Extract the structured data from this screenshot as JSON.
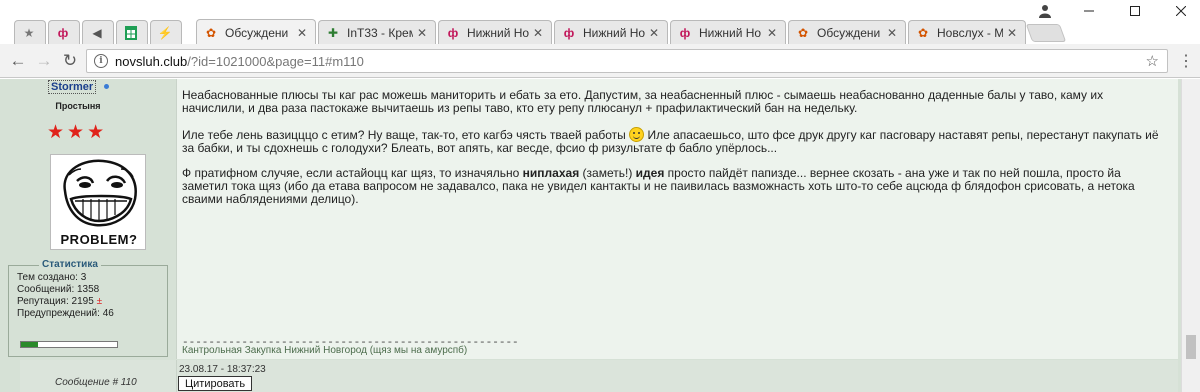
{
  "tabs": [
    {
      "label": "",
      "icon": "star-icon"
    },
    {
      "label": "",
      "icon": "novsluh-favicon"
    },
    {
      "label": "",
      "icon": "speaker-icon"
    },
    {
      "label": "",
      "icon": "sheets-icon"
    },
    {
      "label": "",
      "icon": "bolt-icon"
    },
    {
      "label": "Обсуждени",
      "icon": "forum-favicon",
      "active": true
    },
    {
      "label": "InT33 - Крем",
      "icon": "int33-favicon"
    },
    {
      "label": "Нижний Но",
      "icon": "novsluh-favicon"
    },
    {
      "label": "Нижний Но",
      "icon": "novsluh-favicon"
    },
    {
      "label": "Нижний Но",
      "icon": "novsluh-favicon"
    },
    {
      "label": "Обсуждени",
      "icon": "forum-favicon"
    },
    {
      "label": "Новслух - М",
      "icon": "forum-favicon"
    }
  ],
  "omnibox": {
    "host": "novsluh.club",
    "path": "/?id=1021000&page=11#m110"
  },
  "profile": {
    "username": "Stormer",
    "rank": "Простыня",
    "avatar_caption": "PROBLEM?",
    "stats_title": "Статистика",
    "stats": [
      "Тем создано: 3",
      "Сообщений: 1358",
      "Репутация: 2195",
      "Предупреждений: 46"
    ],
    "rep_sign": "±",
    "rep_fraction": 0.18
  },
  "post": {
    "p1": "Неабаснованные плюсы ты каг рас можешь маниторить и ебать за ето. Дапустим, за неабасненный плюс - сымаешь неабаснованно даденные балы у таво, каму их начислили, и два раза пастокаже вычитаешь из репы таво, кто ету репу плюсанул + прафилактический бан на недельку.",
    "p2a": "Иле тебе лень вазицццо с етим? Ну ваще, так-то, ето кагбэ чясть тваей работы ",
    "p2b": " Иле апасаешьсо, што фсе друк другу каг пасговару наставят репы, перестанут пакупать иё за бабки, и ты сдохнешь с голодухи? Блеать, вот апять, каг весде, фсио ф ризультате ф бабло упёрлось...",
    "p3a": "Ф пратифном случяе, если астайоцц каг щяз, то изначяльно ",
    "p3b": "ниплахая",
    "p3c": " (заметь!) ",
    "p3d": "идея",
    "p3e": " просто пайдёт папизде... вернее скозать - ана уже и так по ней пошла, просто йа заметил тока щяз (ибо да етава вапросом не задавалсо, пака не увидел кантакты и не паивилась вазможнасть хоть што-то себе ацсюда ф блядофон срисовать, а нетока сваими наблядениями делицо)."
  },
  "signature": {
    "line": "---------------------------------------------------",
    "text": "Кантрольная Закупка Нижний Новгород (щяз мы на амурспб)"
  },
  "footer": {
    "message_number": "Сообщение # 110",
    "datetime": "23.08.17 - 18:37:23",
    "quote_button": "Цитировать"
  },
  "colors": {
    "page_bg": "#d6e1d6",
    "post_bg": "#edf3ed",
    "stars": "#e0231b",
    "username": "#1a3e8c"
  }
}
